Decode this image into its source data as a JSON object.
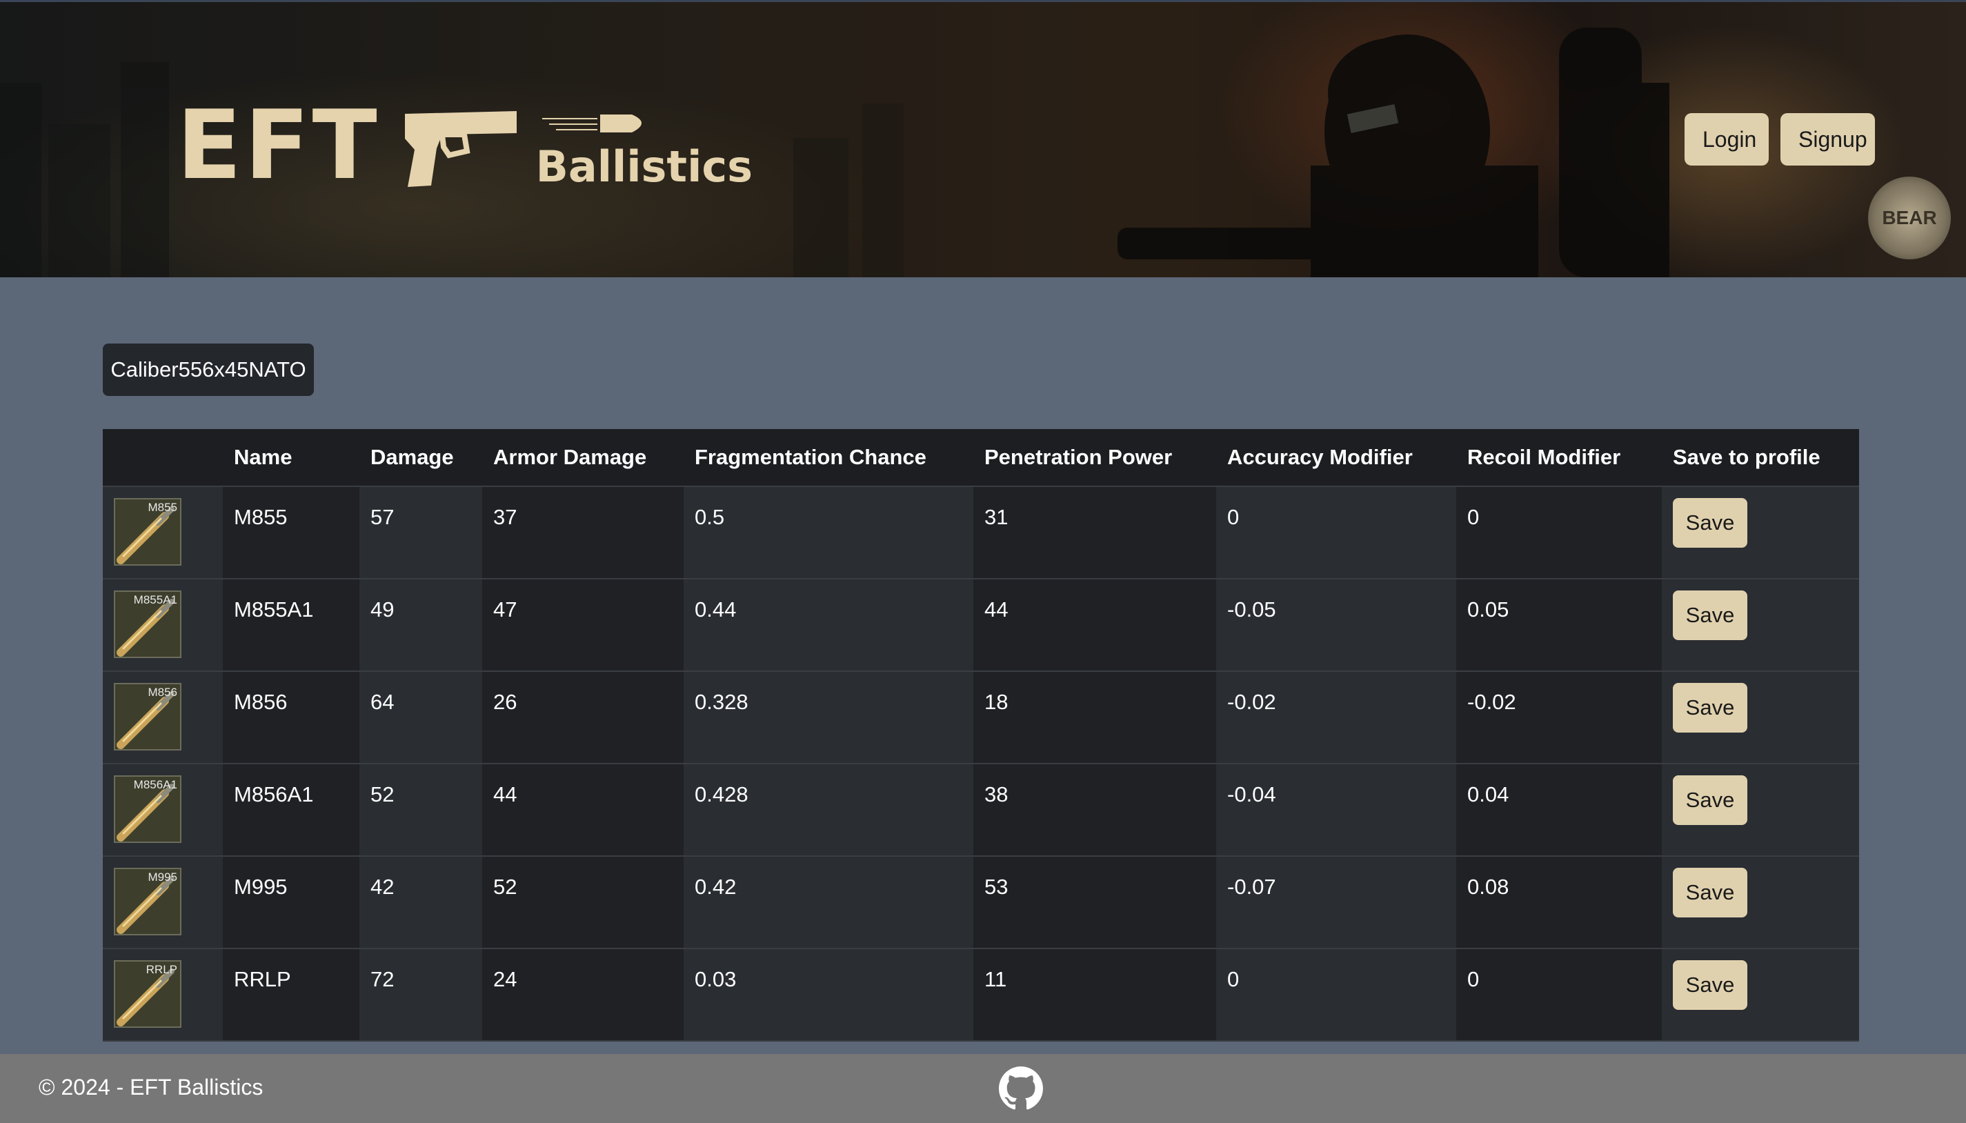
{
  "header": {
    "logo_main": "EFT",
    "logo_sub": "Ballistics",
    "login_label": "Login",
    "signup_label": "Signup",
    "badge_text": "BEAR",
    "accent_color": "#e0d1ae"
  },
  "caliber": {
    "selected": "Caliber556x45NATO"
  },
  "table": {
    "columns": [
      "",
      "Name",
      "Damage",
      "Armor Damage",
      "Fragmentation Chance",
      "Penetration Power",
      "Accuracy Modifier",
      "Recoil Modifier",
      "Save to profile"
    ],
    "rows": [
      {
        "thumb": "M855",
        "name": "M855",
        "damage": "57",
        "armor_damage": "37",
        "frag": "0.5",
        "pen": "31",
        "accuracy": "0",
        "recoil": "0",
        "save": "Save"
      },
      {
        "thumb": "M855A1",
        "name": "M855A1",
        "damage": "49",
        "armor_damage": "47",
        "frag": "0.44",
        "pen": "44",
        "accuracy": "-0.05",
        "recoil": "0.05",
        "save": "Save"
      },
      {
        "thumb": "M856",
        "name": "M856",
        "damage": "64",
        "armor_damage": "26",
        "frag": "0.328",
        "pen": "18",
        "accuracy": "-0.02",
        "recoil": "-0.02",
        "save": "Save"
      },
      {
        "thumb": "M856A1",
        "name": "M856A1",
        "damage": "52",
        "armor_damage": "44",
        "frag": "0.428",
        "pen": "38",
        "accuracy": "-0.04",
        "recoil": "0.04",
        "save": "Save"
      },
      {
        "thumb": "M995",
        "name": "M995",
        "damage": "42",
        "armor_damage": "52",
        "frag": "0.42",
        "pen": "53",
        "accuracy": "-0.07",
        "recoil": "0.08",
        "save": "Save"
      },
      {
        "thumb": "RRLP",
        "name": "RRLP",
        "damage": "72",
        "armor_damage": "24",
        "frag": "0.03",
        "pen": "11",
        "accuracy": "0",
        "recoil": "0",
        "save": "Save"
      }
    ]
  },
  "footer": {
    "copyright": "© 2024 - EFT Ballistics",
    "github_icon": "github-icon"
  }
}
